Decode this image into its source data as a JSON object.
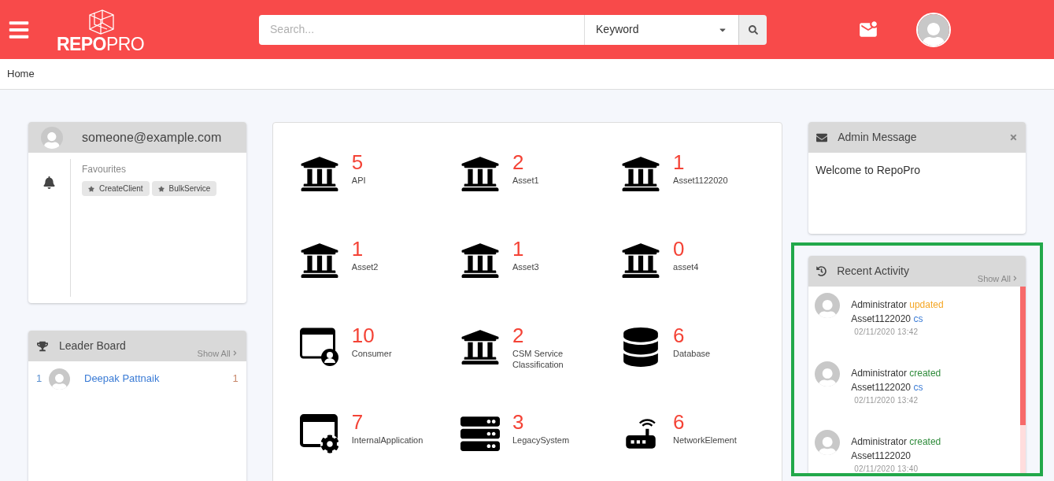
{
  "header": {
    "logo": {
      "strong": "REPO",
      "light": "PRO"
    },
    "search": {
      "placeholder": "Search..."
    },
    "search_type": "Keyword"
  },
  "breadcrumb": "Home",
  "profile": {
    "email": "someone@example.com",
    "favourites_label": "Favourites",
    "favourites": [
      "CreateClient",
      "BulkService"
    ]
  },
  "leader_board": {
    "title": "Leader Board",
    "show_all": "Show All",
    "rows": [
      {
        "rank": "1",
        "name": "Deepak Pattnaik",
        "score": "1"
      }
    ]
  },
  "assets": [
    {
      "kind": "building",
      "count": "5",
      "name": "API"
    },
    {
      "kind": "building",
      "count": "2",
      "name": "Asset1"
    },
    {
      "kind": "building",
      "count": "1",
      "name": "Asset1122020"
    },
    {
      "kind": "building",
      "count": "1",
      "name": "Asset2"
    },
    {
      "kind": "building",
      "count": "1",
      "name": "Asset3"
    },
    {
      "kind": "building",
      "count": "0",
      "name": "asset4"
    },
    {
      "kind": "consumer",
      "count": "10",
      "name": "Consumer"
    },
    {
      "kind": "building",
      "count": "2",
      "name": "CSM Service Classification"
    },
    {
      "kind": "database",
      "count": "6",
      "name": "Database"
    },
    {
      "kind": "app-settings",
      "count": "7",
      "name": "InternalApplication"
    },
    {
      "kind": "server",
      "count": "3",
      "name": "LegacySystem"
    },
    {
      "kind": "router",
      "count": "6",
      "name": "NetworkElement"
    }
  ],
  "admin_message": {
    "title": "Admin Message",
    "text": "Welcome to RepoPro"
  },
  "recent_activity": {
    "title": "Recent Activity",
    "show_all": "Show All",
    "items": [
      {
        "actor": "Administrator",
        "kind": "updated",
        "action": "updated",
        "target": "Asset1122020",
        "suffix": "cs",
        "time": "02/11/2020 13:42"
      },
      {
        "actor": "Administrator",
        "kind": "created",
        "action": "created",
        "target": "Asset1122020",
        "suffix": "cs",
        "time": "02/11/2020 13:42"
      },
      {
        "actor": "Administrator",
        "kind": "created",
        "action": "created",
        "target": "Asset1122020",
        "time": "02/11/2020 13:40"
      }
    ]
  }
}
